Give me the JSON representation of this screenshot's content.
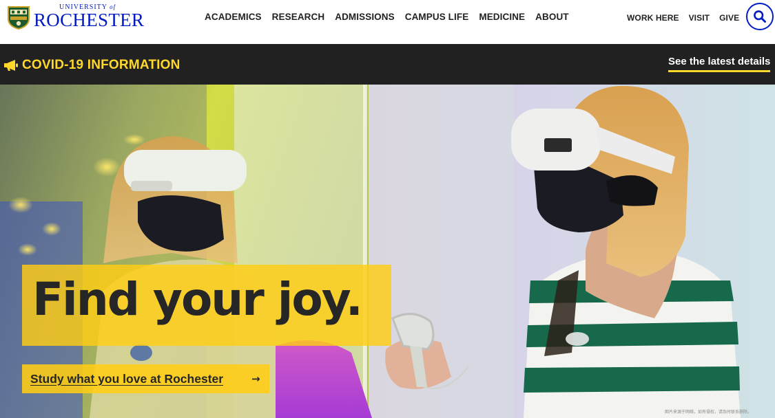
{
  "header": {
    "logo": {
      "small": "UNIVERSITY",
      "of": "of",
      "big": "ROCHESTER",
      "crest_icon": "university-crest-icon"
    },
    "main_nav": [
      "ACADEMICS",
      "RESEARCH",
      "ADMISSIONS",
      "CAMPUS LIFE",
      "MEDICINE",
      "ABOUT"
    ],
    "utility_nav": [
      "WORK HERE",
      "VISIT",
      "GIVE"
    ],
    "search_icon": "search-icon"
  },
  "covid_banner": {
    "icon": "megaphone-icon",
    "title": "COVID-19 INFORMATION",
    "link": "See the latest details"
  },
  "hero": {
    "headline": "Find your joy.",
    "cta": "Study what you love at Rochester",
    "cta_arrow": "→",
    "watermark": "图片来源于网络，如有侵权，请及时联系删除。"
  },
  "colors": {
    "brand_blue": "#021bc3",
    "dandelion_yellow": "#ffd82b",
    "banner_dark": "#212121"
  }
}
